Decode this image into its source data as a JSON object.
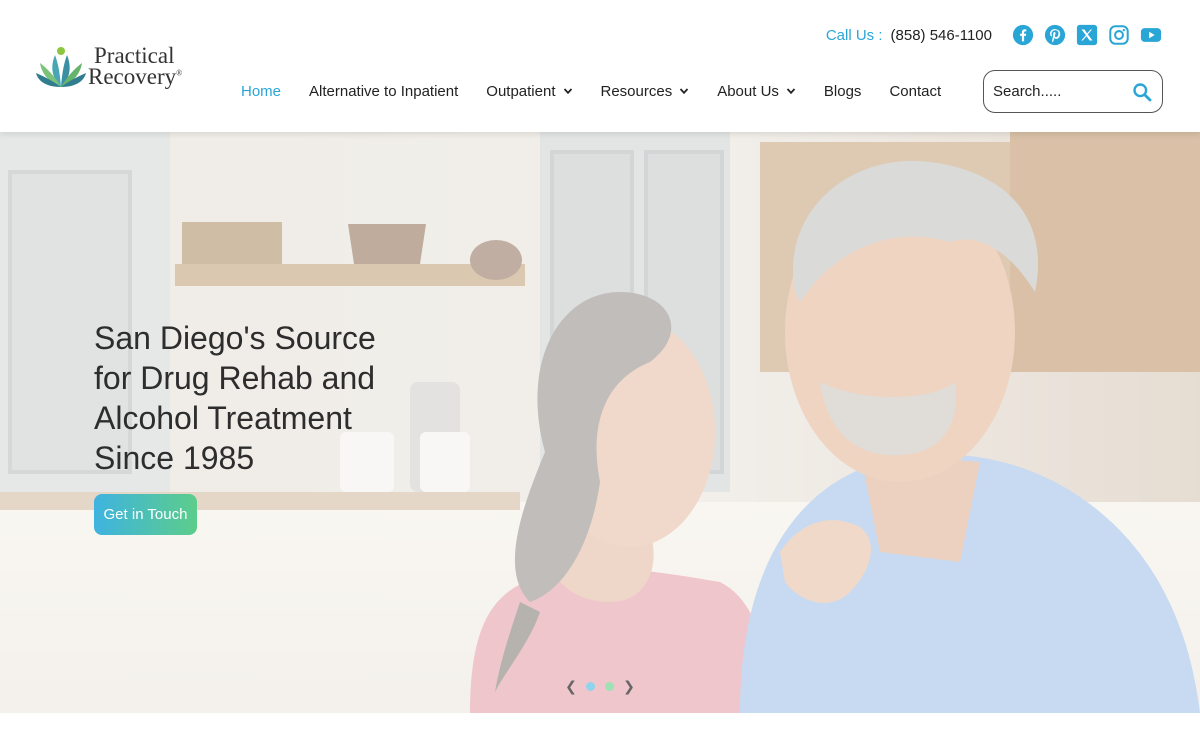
{
  "header": {
    "logo": {
      "line1": "Practical",
      "line2": "Recovery",
      "trademark": "®"
    },
    "contact": {
      "label": "Call Us :",
      "phone": "(858) 546-1100"
    },
    "social": [
      {
        "name": "facebook-icon",
        "color": "#2aa6d6"
      },
      {
        "name": "pinterest-icon",
        "color": "#2aa6d6"
      },
      {
        "name": "x-twitter-icon",
        "color": "#2aa6d6"
      },
      {
        "name": "instagram-icon",
        "color": "#2aa6d6"
      },
      {
        "name": "youtube-icon",
        "color": "#2aa6d6"
      }
    ],
    "nav": [
      {
        "label": "Home",
        "active": true,
        "dropdown": false
      },
      {
        "label": "Alternative to Inpatient",
        "active": false,
        "dropdown": false
      },
      {
        "label": "Outpatient",
        "active": false,
        "dropdown": true
      },
      {
        "label": "Resources",
        "active": false,
        "dropdown": true
      },
      {
        "label": "About Us",
        "active": false,
        "dropdown": true
      },
      {
        "label": "Blogs",
        "active": false,
        "dropdown": false
      },
      {
        "label": "Contact",
        "active": false,
        "dropdown": false
      }
    ],
    "search": {
      "placeholder": "Search.....",
      "value": ""
    }
  },
  "hero": {
    "heading": "San Diego's Source for Drug Rehab and Alcohol Treatment Since 1985",
    "cta_label": "Get in Touch",
    "slider": {
      "prev_icon": "❮",
      "next_icon": "❯",
      "dots": 2
    }
  },
  "colors": {
    "accent": "#2aa6d6",
    "cta_gradient_start": "#3fb3e0",
    "cta_gradient_end": "#5ccd8a"
  }
}
